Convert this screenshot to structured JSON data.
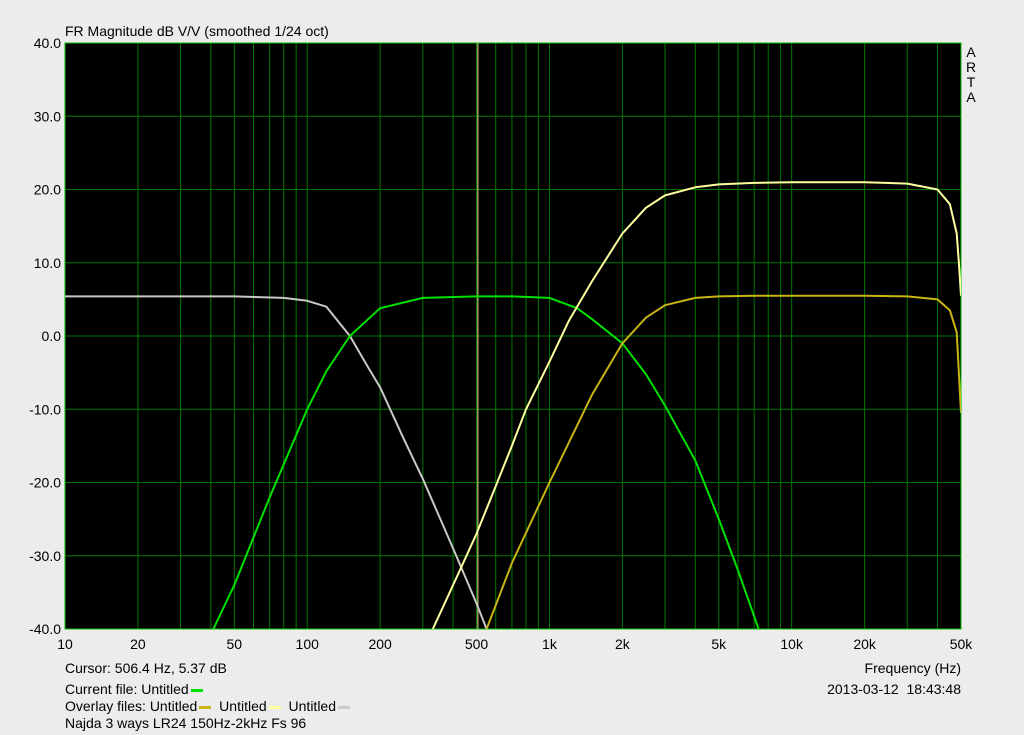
{
  "header": {
    "title": "FR Magnitude dB V/V (smoothed 1/24 oct)",
    "brand": [
      "A",
      "R",
      "T",
      "A"
    ]
  },
  "footer": {
    "cursor_text": "Cursor: 506.4 Hz, 5.37 dB",
    "current_file_prefix": "Current file:",
    "current_file_name": "Untitled",
    "overlay_prefix": "Overlay files:",
    "overlay_files": [
      "Untitled",
      "Untitled",
      "Untitled"
    ],
    "description": "Najda 3 ways LR24 150Hz-2kHz Fs 96",
    "date": "2013-03-12",
    "time": "18:43:48"
  },
  "colors": {
    "background": "#000000",
    "grid": "#007800",
    "frame": "#00c000",
    "cursor": "#e6e68c",
    "current": "#00e000",
    "overlay1": "#c8b414",
    "overlay2": "#ffffa0",
    "overlay3": "#c8c8c8",
    "page": "#ececec"
  },
  "chart_data": {
    "type": "line",
    "title": "FR Magnitude dB V/V (smoothed 1/24 oct)",
    "xlabel": "Frequency (Hz)",
    "ylabel": "",
    "xscale": "log",
    "xlim": [
      10,
      50000
    ],
    "ylim": [
      -40,
      40
    ],
    "grid": true,
    "cursor_x": 506.4,
    "x_ticks": [
      {
        "value": 10,
        "label": "10"
      },
      {
        "value": 20,
        "label": "20"
      },
      {
        "value": 50,
        "label": "50"
      },
      {
        "value": 100,
        "label": "100"
      },
      {
        "value": 200,
        "label": "200"
      },
      {
        "value": 500,
        "label": "500"
      },
      {
        "value": 1000,
        "label": "1k"
      },
      {
        "value": 2000,
        "label": "2k"
      },
      {
        "value": 5000,
        "label": "5k"
      },
      {
        "value": 10000,
        "label": "10k"
      },
      {
        "value": 20000,
        "label": "20k"
      },
      {
        "value": 50000,
        "label": "50k"
      }
    ],
    "y_ticks": [
      {
        "value": 40,
        "label": "40.0"
      },
      {
        "value": 30,
        "label": "30.0"
      },
      {
        "value": 20,
        "label": "20.0"
      },
      {
        "value": 10,
        "label": "10.0"
      },
      {
        "value": 0,
        "label": "0.0"
      },
      {
        "value": -10,
        "label": "-10.0"
      },
      {
        "value": -20,
        "label": "-20.0"
      },
      {
        "value": -30,
        "label": "-30.0"
      },
      {
        "value": -40,
        "label": "-40.0"
      }
    ],
    "series": [
      {
        "color": "#c8c8c8",
        "x": [
          10,
          20,
          50,
          80,
          100,
          120,
          150,
          180,
          200,
          250,
          300,
          400,
          500,
          550
        ],
        "y": [
          5.4,
          5.4,
          5.4,
          5.2,
          4.8,
          4.0,
          0.0,
          -4.5,
          -7.0,
          -14.0,
          -19.5,
          -29.0,
          -36.5,
          -40.0
        ]
      },
      {
        "color": "#00e000",
        "x": [
          41,
          50,
          70,
          100,
          120,
          150,
          200,
          300,
          500,
          700,
          1000,
          1300,
          1500,
          2000,
          2500,
          3000,
          4000,
          5000,
          6000,
          7300
        ],
        "y": [
          -40.0,
          -34.0,
          -22.0,
          -10.0,
          -4.8,
          0.0,
          3.8,
          5.2,
          5.4,
          5.4,
          5.2,
          3.8,
          2.3,
          -1.0,
          -5.2,
          -9.5,
          -17.0,
          -25.0,
          -32.0,
          -40.0
        ]
      },
      {
        "color": "#c8b414",
        "x": [
          550,
          700,
          1000,
          1500,
          2000,
          2500,
          3000,
          4000,
          5000,
          7000,
          10000,
          20000,
          30000,
          40000,
          45000,
          48000,
          50000
        ],
        "y": [
          -40.0,
          -31.0,
          -20.0,
          -8.0,
          -1.0,
          2.5,
          4.2,
          5.2,
          5.4,
          5.5,
          5.5,
          5.5,
          5.4,
          5.0,
          3.5,
          0.5,
          -10.5
        ]
      },
      {
        "color": "#ffffa0",
        "x": [
          330,
          400,
          500,
          600,
          700,
          800,
          1000,
          1200,
          1500,
          2000,
          2500,
          3000,
          4000,
          5000,
          7000,
          10000,
          20000,
          30000,
          40000,
          45000,
          48000,
          49000,
          50000
        ],
        "y": [
          -40.0,
          -34.0,
          -27.0,
          -20.5,
          -15.0,
          -10.0,
          -3.5,
          2.0,
          7.5,
          14.0,
          17.5,
          19.2,
          20.3,
          20.7,
          20.9,
          21.0,
          21.0,
          20.8,
          20.0,
          18.0,
          14.0,
          10.0,
          5.5
        ]
      }
    ]
  }
}
